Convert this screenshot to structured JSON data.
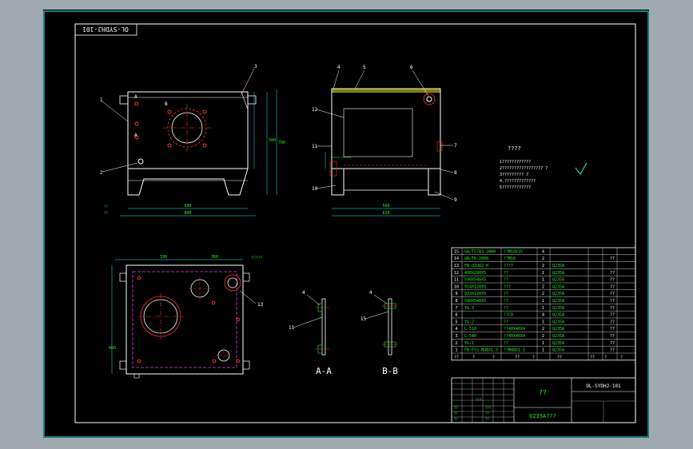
{
  "drawing": {
    "code_label": "OL-SYDHJ-101",
    "section_a_label": "A-A",
    "section_b_label": "B-B",
    "section_mark_a": "A",
    "section_mark_b": "B",
    "colors": {
      "background": "#000000",
      "frame": "#22d3d3",
      "line": "#ffffff",
      "green": "#22ee22",
      "cyan": "#22eeee",
      "red": "#ff3030",
      "magenta": "#ee33ee",
      "yellow": "#ffff33"
    }
  },
  "callouts": {
    "front": [
      "1",
      "2",
      "3"
    ],
    "side": [
      "4",
      "5",
      "6",
      "7",
      "8",
      "9",
      "10",
      "11",
      "12"
    ],
    "top": [
      "13"
    ],
    "section_a": [
      "4",
      "11"
    ],
    "section_b": [
      "4",
      "15"
    ]
  },
  "notes": {
    "title": "????",
    "lines": [
      "1????????????",
      "2????????????????? 7",
      "3????????? 7",
      "4.?????????????",
      "5????????????"
    ]
  },
  "bom": {
    "rows": [
      [
        "15",
        "GB/T5783-2000",
        "??M10X35",
        "4",
        "",
        "",
        ""
      ],
      [
        "14",
        "GB/T6-2000",
        "??M10",
        "2",
        "",
        "",
        "??"
      ],
      [
        "13",
        "FB-QIUQ2-H",
        "????",
        "2",
        "Q235A",
        "",
        ""
      ],
      [
        "12",
        "400X290X5",
        "??",
        "1",
        "Q235A",
        "",
        "??"
      ],
      [
        "11",
        "590X540X5",
        "??",
        "1",
        "Q235A",
        "",
        "??"
      ],
      [
        "10",
        "914X120X5",
        "???",
        "2",
        "Q235A",
        "",
        "??"
      ],
      [
        "9",
        "933X120X5",
        "??",
        "2",
        "Q235A",
        "",
        "??"
      ],
      [
        "8",
        "590X540X5",
        "??",
        "1",
        "Q235A",
        "",
        "??"
      ],
      [
        "7",
        "YG-3",
        "??",
        "1",
        "Q235A",
        "",
        "??"
      ],
      [
        "6",
        "",
        "??C0",
        "4",
        "Q235A",
        "",
        "??"
      ],
      [
        "5",
        "YG-2",
        "??",
        "1",
        "Q235A",
        "",
        "??"
      ],
      [
        "4",
        "L-510",
        "??40X40X4",
        "2",
        "Q235A",
        "",
        "??"
      ],
      [
        "3",
        "L-540",
        "??40X40X4",
        "2",
        "Q235A",
        "",
        "??"
      ],
      [
        "2",
        "YG-1",
        "??",
        "1",
        "Q235A",
        "",
        "??"
      ],
      [
        "1",
        "FB-FY2-M48X1.5",
        "??M48X1.5",
        "1",
        "Q235A",
        "",
        "??"
      ]
    ],
    "header": [
      "??",
      "?",
      "?",
      "??",
      "?",
      "??",
      "??",
      "?",
      "?"
    ]
  },
  "title_block": {
    "name": "??",
    "material": "Q235A???",
    "drawing_no": "OL-SYDHJ-101",
    "scale": "1:1",
    "small": [
      "??",
      "??",
      "???",
      "??",
      "???",
      "??",
      "??",
      "??",
      "??"
    ]
  },
  "dims": {
    "front_width": "800",
    "front_height": "700",
    "front_inner_height": "500",
    "front_base": "600",
    "front_side_a": "310",
    "front_side_b": "120",
    "top_left": "330",
    "top_right": "360",
    "top_depth": "460",
    "side_width": "620",
    "side_bottom": "560",
    "weld_note": "??????",
    "weld_note2": "??"
  }
}
